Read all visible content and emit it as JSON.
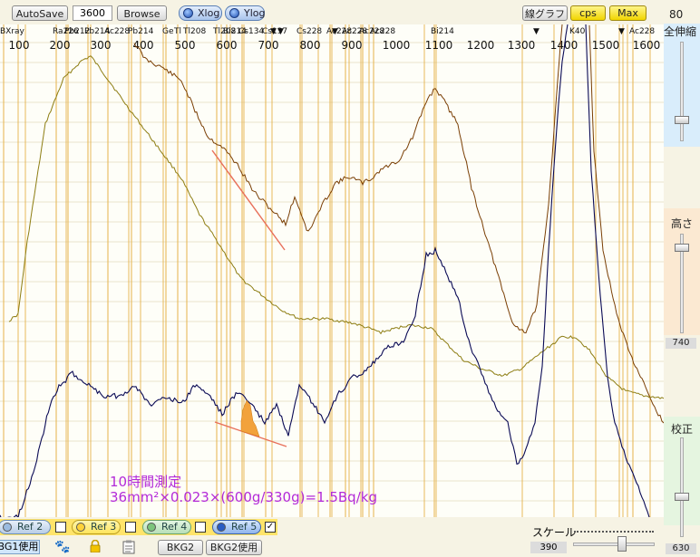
{
  "toolbar": {
    "autosave_label": "AutoSave",
    "time_value": "3600",
    "browse_label": "Browse",
    "xlog_label": "Xlog",
    "ylog_label": "Ylog",
    "line_graph_label": "線グラフ",
    "cps_label": "cps",
    "max_label": "Max"
  },
  "right_panel": {
    "top_value": "80",
    "stretch_label": "全伸縮",
    "height_label": "高さ",
    "height_value": "740",
    "calibrate_label": "校正",
    "calibrate_value": "630"
  },
  "chart": {
    "nuclide_labels": [
      "BXray",
      "Ra226",
      "Pb212",
      "Pb214",
      "Ac228",
      "Pb214",
      "Ge",
      "Tl",
      "Tl208",
      "Tl208",
      "Bi214",
      "Cs134",
      "Cs137",
      "Cs228",
      "Ac228",
      "Ac228",
      "Ac228",
      "Ac228",
      "Bi214",
      "K40",
      "Ac228"
    ],
    "x_ticks": [
      "100",
      "200",
      "300",
      "400",
      "500",
      "600",
      "700",
      "800",
      "900",
      "1000",
      "1100",
      "1200",
      "1300",
      "1400",
      "1500",
      "1600"
    ],
    "annotation_title": "10時間測定",
    "annotation_formula": "36mm²×0.023×(600g/330g)=1.5Bq/kg",
    "colors": {
      "series1": "#7a3f05",
      "series2": "#8d7d12",
      "series3": "#0a0a55",
      "marker": "#f2a23c",
      "annotation": "#b32ad8",
      "fit_line": "#e8705a"
    }
  },
  "bottom": {
    "refs": [
      {
        "label": "Ref 2",
        "checked": false
      },
      {
        "label": "Ref 3",
        "checked": false
      },
      {
        "label": "Ref 4",
        "checked": false
      },
      {
        "label": "Ref 5",
        "checked": true
      }
    ],
    "bg1_label": "BG1使用",
    "bkg2_label": "BKG2",
    "bkg2_use_label": "BKG2使用",
    "scale_label": "スケール",
    "scale_value": "390"
  }
}
